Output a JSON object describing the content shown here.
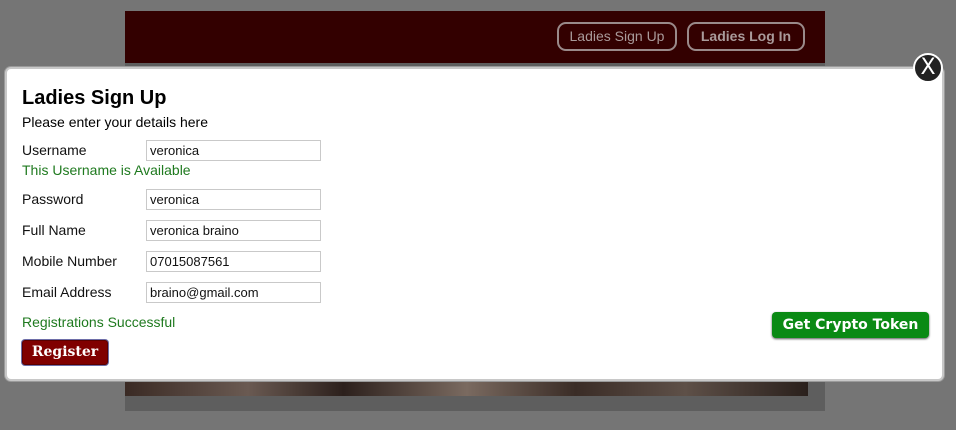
{
  "header": {
    "signup_label": "Ladies Sign Up",
    "login_label": "Ladies Log In"
  },
  "modal": {
    "close_label": "X",
    "title": "Ladies Sign Up",
    "subtitle": "Please enter your details here",
    "fields": {
      "username": {
        "label": "Username",
        "value": "veronica"
      },
      "password": {
        "label": "Password",
        "value": "veronica"
      },
      "full_name": {
        "label": "Full Name",
        "value": "veronica braino"
      },
      "mobile": {
        "label": "Mobile Number",
        "value": "07015087561"
      },
      "email": {
        "label": "Email Address",
        "value": "braino@gmail.com"
      }
    },
    "username_status": "This Username is Available",
    "registration_status": "Registrations Successful",
    "register_label": "Register",
    "crypto_label": "Get Crypto Token"
  },
  "colors": {
    "header_bg": "#330000",
    "register_bg": "#800000",
    "crypto_bg": "#0a8a14",
    "success_text": "#1f7a1f"
  }
}
